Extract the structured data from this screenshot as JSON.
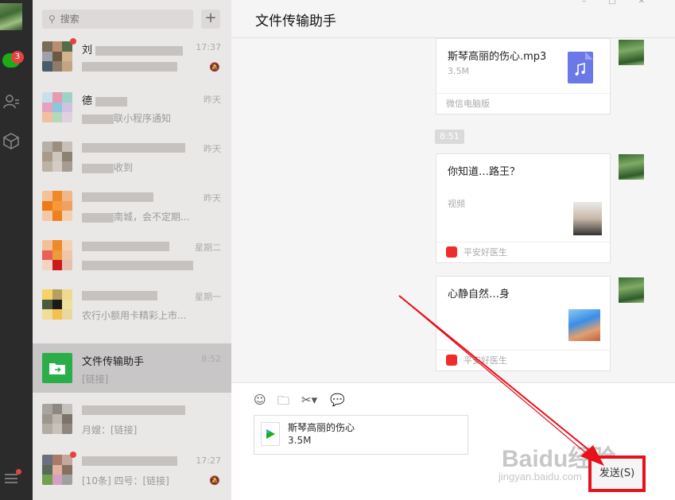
{
  "rail": {
    "chat_badge": "3"
  },
  "search": {
    "placeholder": "搜索",
    "add_label": "+"
  },
  "conversations": [
    {
      "name": "刘",
      "preview": "",
      "time": "17:37",
      "muted": true,
      "unread_dot": true
    },
    {
      "name": "德",
      "preview": "联小程序通知",
      "time": "昨天",
      "muted": false,
      "unread_dot": false
    },
    {
      "name": "",
      "preview": "收到",
      "time": "昨天",
      "muted": false,
      "unread_dot": false
    },
    {
      "name": "",
      "preview": "南城，会不定期...",
      "time": "昨天",
      "muted": false,
      "unread_dot": false
    },
    {
      "name": "",
      "preview": "",
      "time": "星期二",
      "muted": false,
      "unread_dot": false
    },
    {
      "name": "",
      "preview": "农行小额用卡精彩上市...",
      "time": "星期一",
      "muted": false,
      "unread_dot": false
    },
    {
      "name": "文件传输助手",
      "preview": "[链接]",
      "time": "8:52",
      "muted": false,
      "unread_dot": false,
      "active": true
    },
    {
      "name": "",
      "preview": "月嫂：[链接]",
      "time": "",
      "muted": false,
      "unread_dot": false
    },
    {
      "name": "",
      "preview": "[10条] 四号：[链接]",
      "time": "17:27",
      "muted": true,
      "unread_dot": true
    }
  ],
  "chat": {
    "title": "文件传输助手",
    "messages": [
      {
        "title": "斯琴高丽的伤心.mp3",
        "sub": "3.5M",
        "footer": "微信电脑版"
      },
      {
        "title": "你知道…路王？",
        "sub": "视频",
        "footer": "平安好医生"
      },
      {
        "title": "心静自然…身",
        "sub": "",
        "footer": "平安好医生"
      }
    ],
    "time_separator": "8:51"
  },
  "input": {
    "file_name": "斯琴高丽的伤心",
    "file_size": "3.5M",
    "send_label": "发送(S)"
  },
  "watermark": {
    "brand": "Baidu经验",
    "url": "jingyan.baidu.com"
  }
}
